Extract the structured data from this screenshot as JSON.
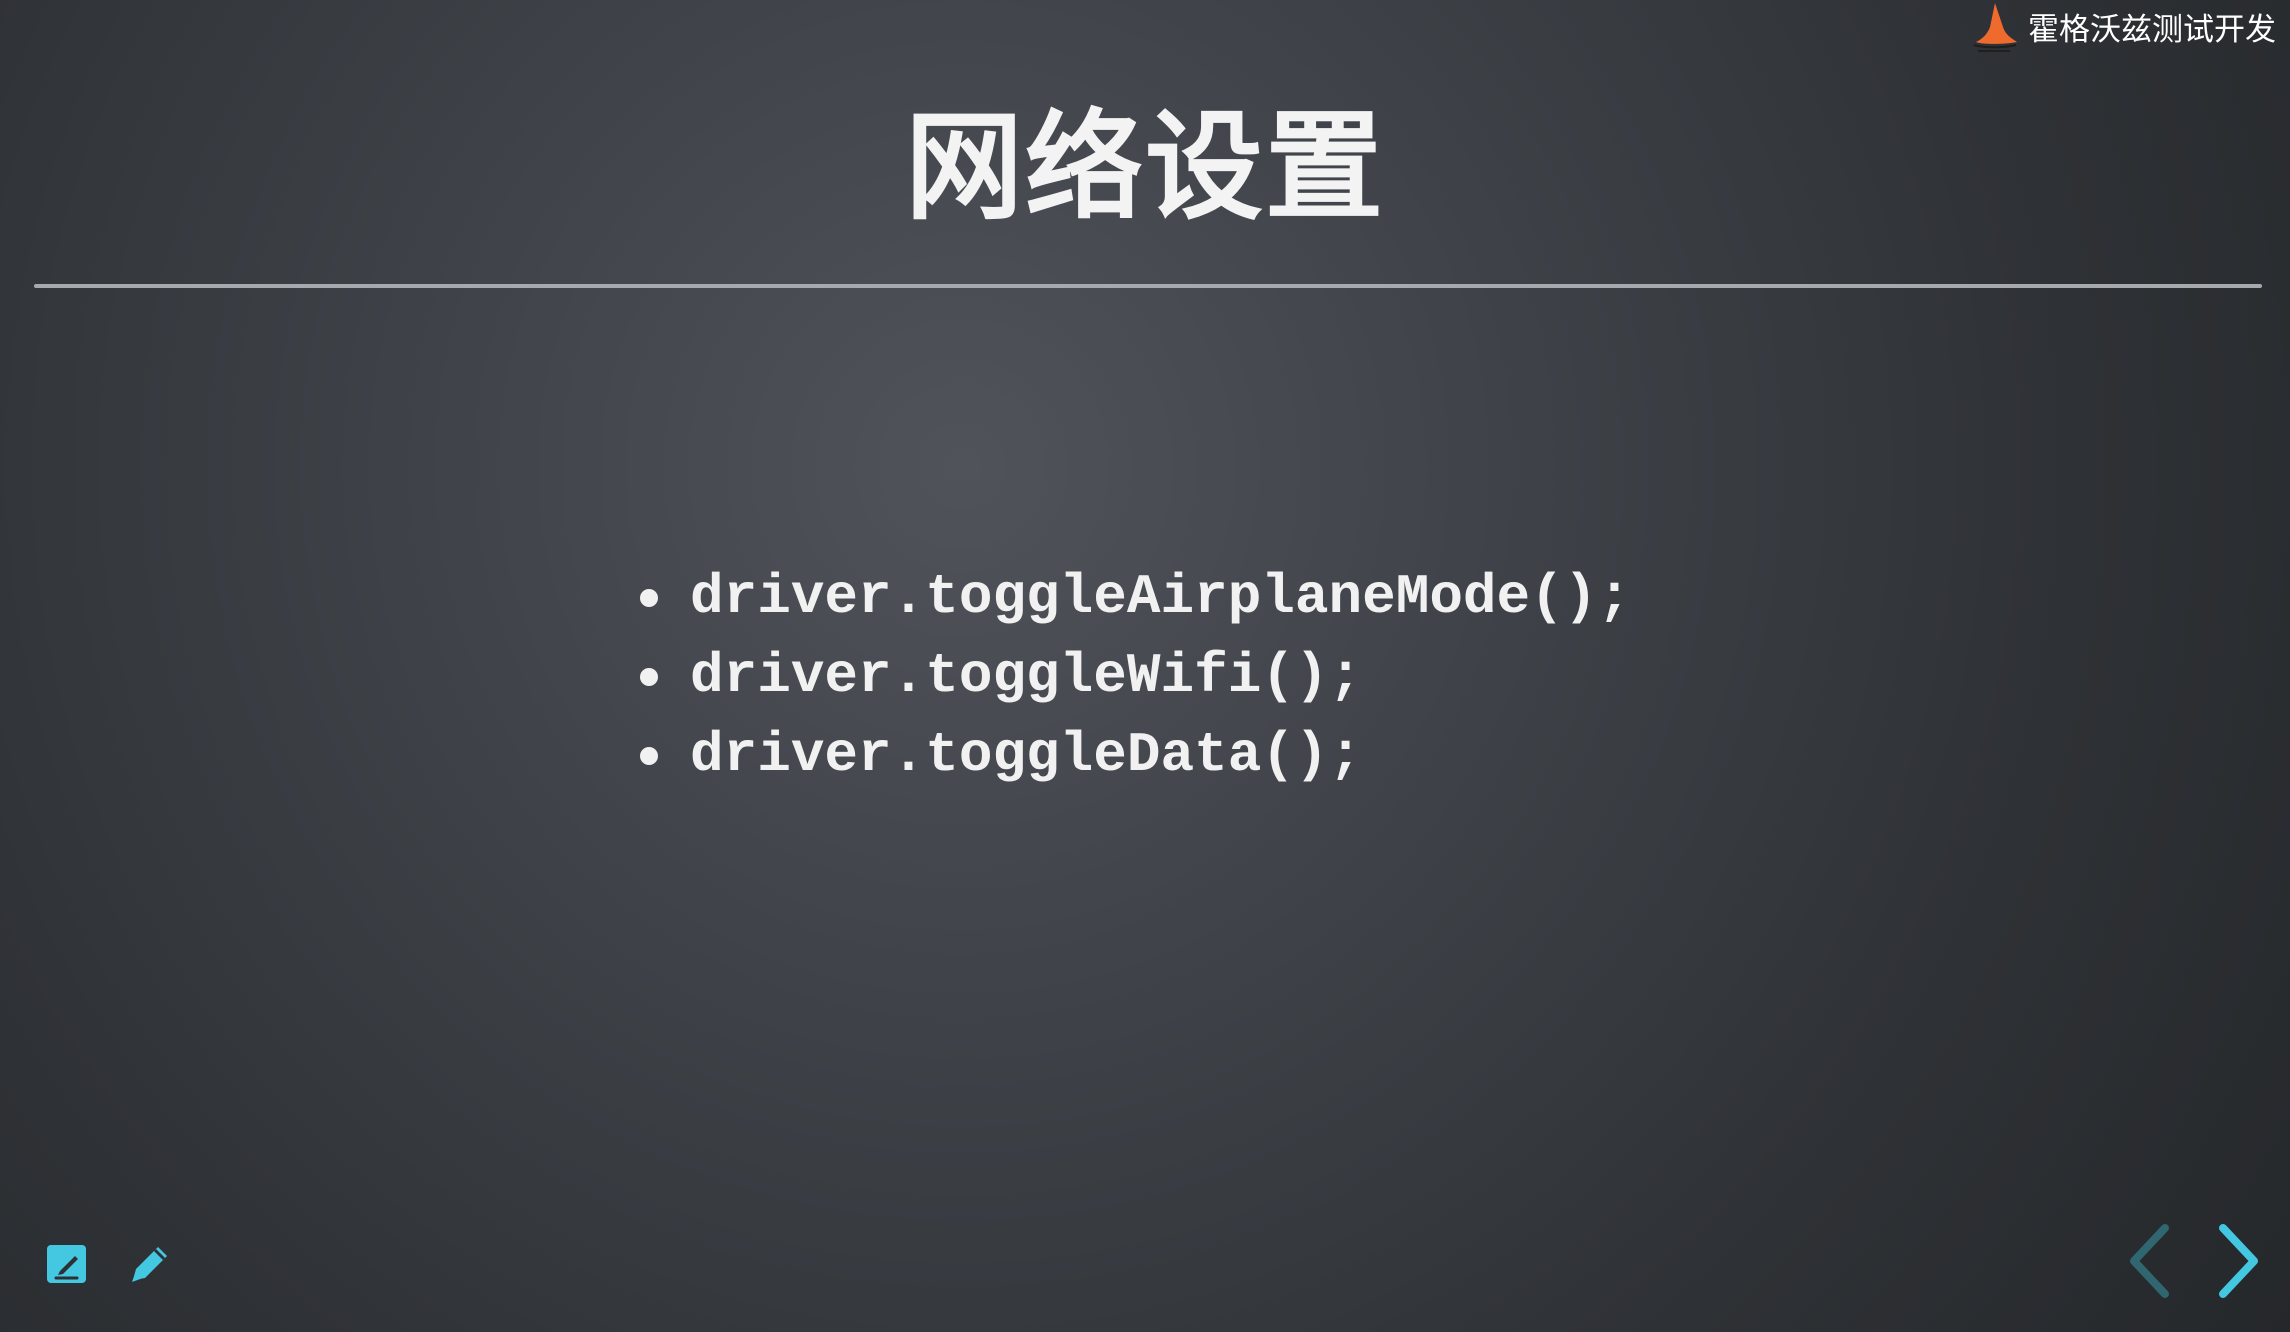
{
  "brand": {
    "name": "霍格沃兹测试开发",
    "logo_icon": "witch-hat-icon",
    "logo_color": "#ee6b2d"
  },
  "slide": {
    "title": "网络设置",
    "bullets": [
      "driver.toggleAirplaneMode();",
      "driver.toggleWifi();",
      "driver.toggleData();"
    ]
  },
  "toolbar": {
    "left_icons": [
      "edit-note-icon",
      "pencil-icon"
    ],
    "accent": "#44c7e1"
  },
  "navigation": {
    "previous_icon": "chevron-left-icon",
    "next_icon": "chevron-right-icon",
    "previous_color": "#2f6670",
    "next_color": "#44c7e1"
  }
}
